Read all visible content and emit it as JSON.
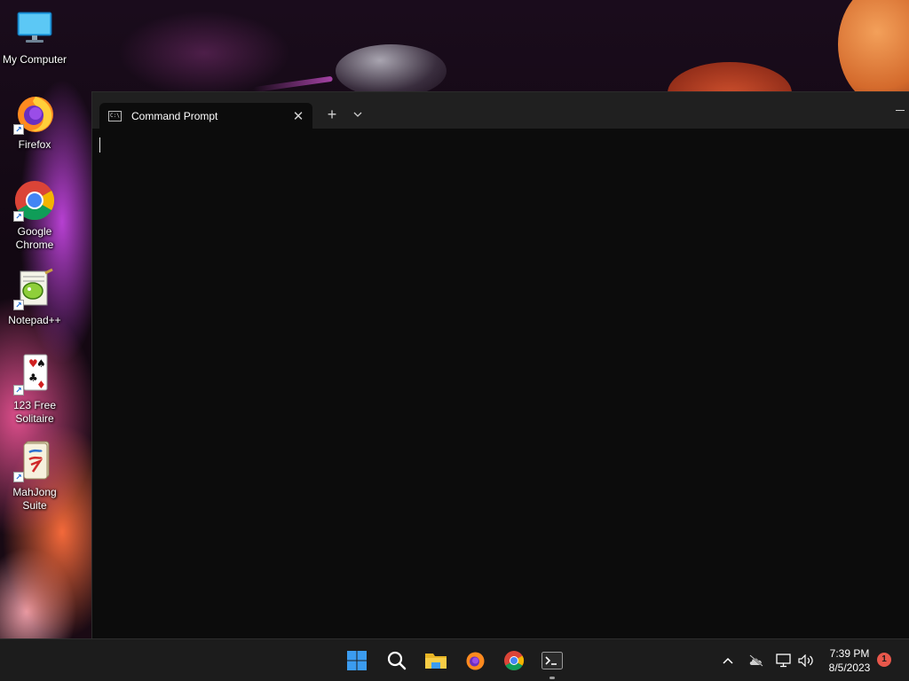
{
  "desktop": {
    "icons": [
      {
        "label": "My Computer",
        "icon": "monitor-icon"
      },
      {
        "label": "Firefox",
        "icon": "firefox-icon"
      },
      {
        "label": "Google Chrome",
        "icon": "chrome-icon"
      },
      {
        "label": "Notepad++",
        "icon": "notepad-plus-plus-icon"
      },
      {
        "label": "123 Free Solitaire",
        "icon": "solitaire-cards-icon"
      },
      {
        "label": "MahJong Suite",
        "icon": "mahjong-tile-icon"
      }
    ]
  },
  "terminal": {
    "tab_title": "Command Prompt",
    "tab_icon": "cmd-icon",
    "close_glyph": "✕",
    "new_tab_glyph": "+",
    "console_text": ""
  },
  "taskbar": {
    "apps": [
      "start-icon",
      "search-icon",
      "file-explorer-icon",
      "firefox-icon",
      "chrome-icon",
      "terminal-icon"
    ],
    "active_app": "terminal-icon",
    "tray_icons": [
      "chevron-up-icon",
      "cloud-offline-icon",
      "network-icon",
      "volume-icon"
    ],
    "time": "7:39 PM",
    "date": "8/5/2023",
    "notification_count": "1"
  },
  "colors": {
    "terminal_bg": "#0c0c0c",
    "titlebar_bg": "#202020",
    "taskbar_bg": "#1c1c1c",
    "notification_badge": "#e8574b",
    "windows_accent": "#3b9cf0"
  }
}
